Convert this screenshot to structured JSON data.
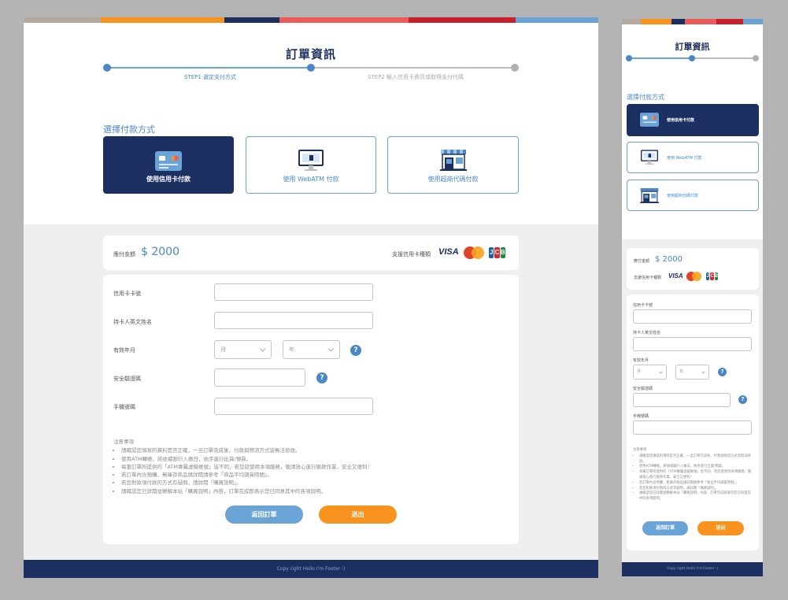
{
  "colors": {
    "navy": "#1b2f61",
    "blue": "#4a87c5",
    "light_blue": "#6aa3d6",
    "orange": "#f7931e",
    "gray_bg": "#efefed"
  },
  "color_bar": [
    "#b5a89e",
    "#f7931e",
    "#1b2f61",
    "#ee5a5a",
    "#c8202a",
    "#6aa3d6"
  ],
  "page_title": "訂單資訊",
  "steps": [
    {
      "label": "STEP1 選定支付方式"
    },
    {
      "label": "STEP2 輸入信用卡資訊或取得支付代碼"
    }
  ],
  "payment": {
    "section_title": "選擇付款方式",
    "methods": [
      {
        "label": "使用信用卡付款",
        "icon": "credit-card-icon"
      },
      {
        "label": "使用 WebATM 付款",
        "icon": "monitor-icon"
      },
      {
        "label": "使用超商代碼付款",
        "icon": "store-icon"
      }
    ],
    "methods_mobile": [
      {
        "label": "使用信用卡付款"
      },
      {
        "label": "使用 WebATM 付款"
      },
      {
        "label": "使用超商代碼付款"
      }
    ]
  },
  "amount": {
    "label": "應付金額",
    "value": "$ 2000",
    "supported_label": "支援信用卡種類",
    "brands": {
      "visa": "VISA",
      "mastercard_icon": "mastercard-icon",
      "jcb": [
        "J",
        "C",
        "B"
      ]
    }
  },
  "form": {
    "card_number_label": "信用卡卡號",
    "holder_label": "持卡人英文姓名",
    "expiry_label": "有效年月",
    "month_placeholder": "月",
    "year_placeholder": "年",
    "cvv_label": "安全驗證碼",
    "phone_label": "手機號碼",
    "help_symbol": "?"
  },
  "notes": {
    "title": "注意事項",
    "items": [
      "請確認您填寫的資料是否正確，一旦訂單完成後，付款與物流方式皆無法修改。",
      "使用ATM轉帳，將依據銀行入帳日，依序進行出貨/預貨。",
      "每筆訂單所提供的「ATM專屬虛擬帳號」皆不同，若您欲使用本項服務，敬請放心進行匯款作業，安全又便利！",
      "若訂單內含預購，無庫存商品請詳閱請參考「商品平均調貨時間」。",
      "若您對款項付款的方式有疑問，請詳閱「購買說明」。",
      "請確認您已詳閱並瞭解本站「購買說明」內容，訂單完成即表示您已同意其中的各項說明。"
    ]
  },
  "buttons": {
    "back": "返回訂單",
    "exit": "送出"
  },
  "footer": "Copy right Hello I'm Footer :)"
}
